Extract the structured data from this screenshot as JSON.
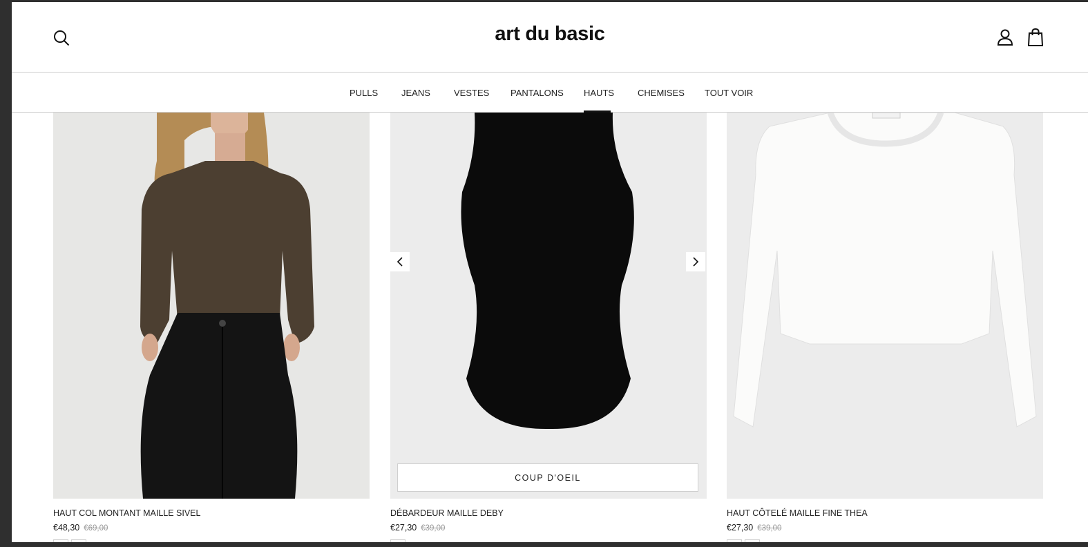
{
  "header": {
    "logo": "art du basic",
    "icons": [
      "search-icon",
      "account-icon",
      "cart-icon"
    ]
  },
  "nav": {
    "items": [
      "PULLS",
      "JEANS",
      "VESTES",
      "PANTALONS",
      "HAUTS",
      "CHEMISES",
      "TOUT VOIR"
    ],
    "active": "HAUTS"
  },
  "products": [
    {
      "title": "HAUT COL MONTANT MAILLE SIVEL",
      "price": "€48,30",
      "old_price": "€69,00"
    },
    {
      "title": "DÉBARDEUR MAILLE DEBY",
      "price": "€27,30",
      "old_price": "€39,00",
      "quick_view": "COUP D'OEIL"
    },
    {
      "title": "HAUT CÔTELÉ MAILLE FINE THEA",
      "price": "€27,30",
      "old_price": "€39,00"
    }
  ],
  "colors": {
    "photo_bg": "#ececec",
    "chrome": "#2f2f2f",
    "old_price": "#9a9a9a"
  }
}
